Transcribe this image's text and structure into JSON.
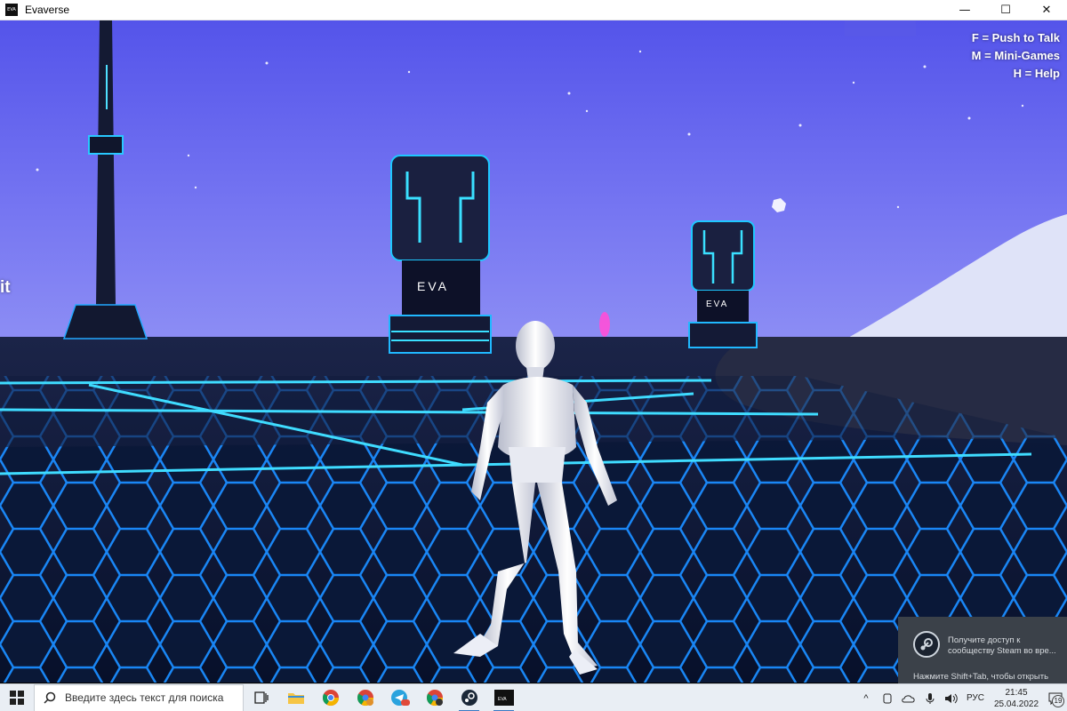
{
  "window": {
    "title": "Evaverse",
    "icon_label": "EVA",
    "minimize": "—",
    "maximize": "☐",
    "close": "✕"
  },
  "hud": {
    "hints": [
      "F = Push to Talk",
      "M = Mini-Games",
      "H = Help"
    ],
    "left_cut_text": "it"
  },
  "scene": {
    "tower_logo_left": "EVA",
    "tower_logo_right": "EVA",
    "tower_small_logo": "EVA"
  },
  "steam_notification": {
    "message": "Получите доступ к сообществу Steam во вре...",
    "hint": "Нажмите Shift+Tab, чтобы открыть"
  },
  "taskbar": {
    "search_placeholder": "Введите здесь текст для поиска",
    "apps": [
      "task-view",
      "file-explorer",
      "chrome",
      "chrome-profile",
      "telegram",
      "chrome-profile-2",
      "steam",
      "evaverse"
    ],
    "telegram_badge": "80",
    "language": "РУС",
    "time": "21:45",
    "date": "25.04.2022",
    "notification_count": "19"
  },
  "colors": {
    "sky": "#6a6af0",
    "floor": "#0b1530",
    "neon": "#1ec8ff",
    "accent_blue": "#3a78c4"
  }
}
